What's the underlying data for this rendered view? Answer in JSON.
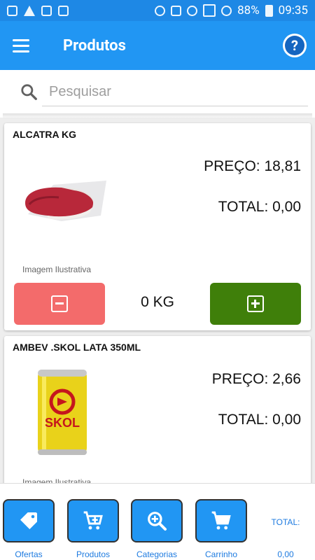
{
  "status_bar": {
    "battery": "88%",
    "time": "09:35"
  },
  "app_bar": {
    "title": "Produtos"
  },
  "search": {
    "placeholder": "Pesquisar"
  },
  "products": [
    {
      "name": "ALCATRA KG",
      "price": "PREÇO: 18,81",
      "total": "TOTAL: 0,00",
      "image_caption": "Imagem Ilustrativa",
      "quantity": "0 KG"
    },
    {
      "name": "AMBEV .SKOL LATA 350ML",
      "price": "PREÇO: 2,66",
      "total": "TOTAL: 0,00",
      "image_caption": "Imagem Ilustrativa",
      "image_logo_text": "SKOL"
    }
  ],
  "bottom_nav": {
    "items": [
      {
        "label": "Ofertas",
        "icon": "tag-icon"
      },
      {
        "label": "Produtos",
        "icon": "cart-add-icon"
      },
      {
        "label": "Categorias",
        "icon": "zoom-in-icon"
      },
      {
        "label": "Carrinho",
        "icon": "cart-icon"
      }
    ],
    "total_label": "TOTAL:",
    "total_value": "0,00"
  },
  "colors": {
    "primary": "#2196f3",
    "status_bar": "#1e88e5",
    "minus_button": "#f36b6b",
    "plus_button": "#3f7f0a"
  }
}
